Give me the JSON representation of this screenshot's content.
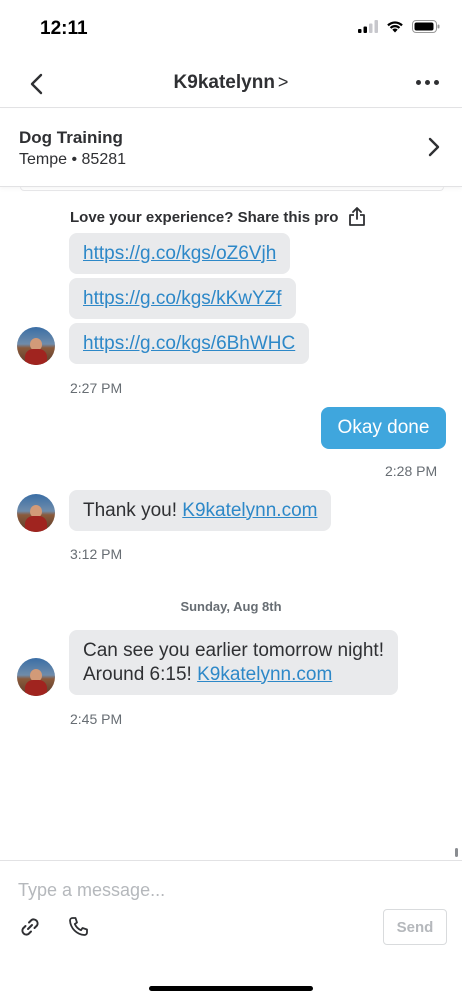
{
  "status_bar": {
    "time": "12:11"
  },
  "header": {
    "title": "K9katelynn",
    "title_chevron": ">"
  },
  "project": {
    "title": "Dog Training",
    "location": "Tempe • 85281"
  },
  "share": {
    "heading": "Love your experience? Share this pro",
    "links": [
      "https://g.co/kgs/oZ6Vjh",
      "https://g.co/kgs/kKwYZf",
      "https://g.co/kgs/6BhWHC"
    ],
    "time": "2:27 PM"
  },
  "messages": {
    "outgoing_1": {
      "text": "Okay done",
      "time": "2:28 PM"
    },
    "incoming_1": {
      "text": "Thank you! ",
      "link": "K9katelynn.com",
      "time": "3:12 PM"
    },
    "date_separator": "Sunday, Aug 8th",
    "incoming_2": {
      "line1": "Can see you earlier tomorrow night!",
      "line2": "Around 6:15! ",
      "link": "K9katelynn.com",
      "time": "2:45 PM"
    }
  },
  "composer": {
    "placeholder": "Type a message...",
    "send_label": "Send"
  },
  "colors": {
    "accent": "#3fa6dd",
    "link": "#2d88c8",
    "bubble": "#e9eaec",
    "text": "#2f3033"
  },
  "icons": [
    "back-arrow-icon",
    "more-icon",
    "chevron-right-icon",
    "share-icon",
    "attachment-icon",
    "phone-icon",
    "signal-icon",
    "wifi-icon",
    "battery-icon"
  ]
}
